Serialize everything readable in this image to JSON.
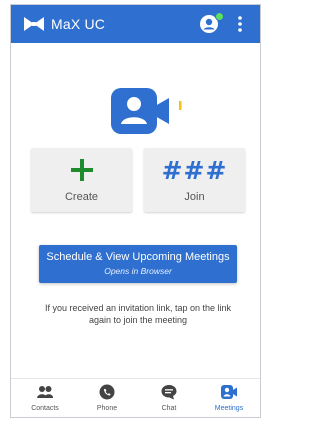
{
  "header": {
    "title": "MaX UC",
    "logo_icon": "bowtie-logo-icon",
    "profile_icon": "account-icon",
    "status_color": "#5ce05c",
    "menu_icon": "more-vert-icon"
  },
  "hero": {
    "icon": "video-user-icon"
  },
  "actions": {
    "create": {
      "glyph": "+",
      "label": "Create"
    },
    "join": {
      "glyph": "###",
      "label": "Join"
    }
  },
  "schedule": {
    "label": "Schedule & View Upcoming Meetings",
    "sublabel": "Opens in Browser"
  },
  "hint": "If you received an invitation link, tap on the link again to join the meeting",
  "bottom_nav": [
    {
      "label": "Contacts",
      "icon": "contacts-icon",
      "active": false
    },
    {
      "label": "Phone",
      "icon": "phone-icon",
      "active": false
    },
    {
      "label": "Chat",
      "icon": "chat-icon",
      "active": false
    },
    {
      "label": "Meetings",
      "icon": "meetings-icon",
      "active": true
    }
  ],
  "colors": {
    "brand": "#2e6fcf",
    "create_green": "#1e8c2c",
    "accent_yellow": "#f2c21c"
  }
}
